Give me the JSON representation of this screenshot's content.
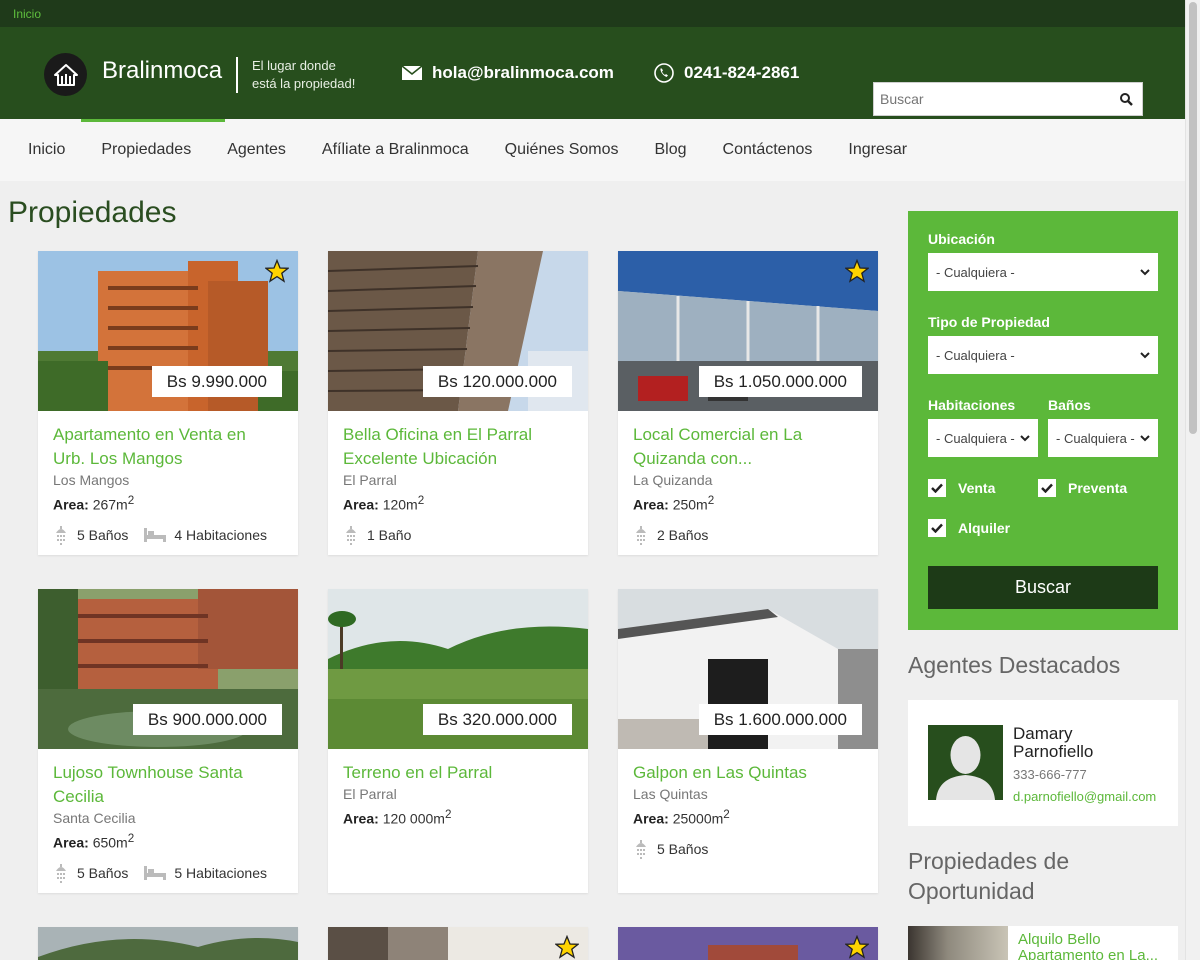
{
  "topbar": {
    "breadcrumb": "Inicio"
  },
  "header": {
    "brand": "Bralinmoca",
    "tagline_line1": "El lugar donde",
    "tagline_line2": "está la propiedad!",
    "email": "hola@bralinmoca.com",
    "phone": "0241-824-2861",
    "search_placeholder": "Buscar"
  },
  "nav": {
    "items": [
      {
        "label": "Inicio"
      },
      {
        "label": "Propiedades"
      },
      {
        "label": "Agentes"
      },
      {
        "label": "Afíliate a Bralinmoca"
      },
      {
        "label": "Quiénes Somos"
      },
      {
        "label": "Blog"
      },
      {
        "label": "Contáctenos"
      },
      {
        "label": "Ingresar"
      }
    ]
  },
  "main": {
    "title": "Propiedades",
    "properties": [
      {
        "price": "Bs 9.990.000",
        "title1": "Apartamento en Venta en",
        "title2": "Urb. Los Mangos",
        "location": "Los Mangos",
        "area_label": "Area:",
        "area": "267m",
        "baths": "5 Baños",
        "rooms": "4 Habitaciones",
        "featured": true
      },
      {
        "price": "Bs 120.000.000",
        "title1": "Bella Oficina en El Parral",
        "title2": "Excelente Ubicación",
        "location": "El Parral",
        "area_label": "Area:",
        "area": "120m",
        "baths": "1 Baño",
        "rooms": "",
        "featured": false
      },
      {
        "price": "Bs 1.050.000.000",
        "title1": "Local Comercial en La",
        "title2": "Quizanda con...",
        "location": "La Quizanda",
        "area_label": "Area:",
        "area": "250m",
        "baths": "2 Baños",
        "rooms": "",
        "featured": true
      },
      {
        "price": "Bs 900.000.000",
        "title1": "Lujoso Townhouse Santa",
        "title2": "Cecilia",
        "location": "Santa Cecilia",
        "area_label": "Area:",
        "area": "650m",
        "baths": "5 Baños",
        "rooms": "5 Habitaciones",
        "featured": false
      },
      {
        "price": "Bs 320.000.000",
        "title1": "Terreno en el Parral",
        "title2": "",
        "location": "El Parral",
        "area_label": "Area:",
        "area": "120 000m",
        "baths": "",
        "rooms": "",
        "featured": false
      },
      {
        "price": "Bs 1.600.000.000",
        "title1": "Galpon en Las Quintas",
        "title2": "",
        "location": "Las Quintas",
        "area_label": "Area:",
        "area": "25000m",
        "baths": "5 Baños",
        "rooms": "",
        "featured": false
      }
    ],
    "area_sup": "2"
  },
  "filter": {
    "ubicacion_label": "Ubicación",
    "ubicacion_value": "- Cualquiera -",
    "tipo_label": "Tipo de Propiedad",
    "tipo_value": "- Cualquiera -",
    "habitaciones_label": "Habitaciones",
    "habitaciones_value": "- Cualquiera -",
    "banos_label": "Baños",
    "banos_value": "- Cualquiera -",
    "venta": "Venta",
    "preventa": "Preventa",
    "alquiler": "Alquiler",
    "button": "Buscar"
  },
  "sidebar": {
    "agents_title": "Agentes Destacados",
    "agent": {
      "name_line1": "Damary",
      "name_line2": "Parnofiello",
      "phone": "333-666-777",
      "email": "d.parnofiello@gmail.com"
    },
    "opportunity_title_line1": "Propiedades de",
    "opportunity_title_line2": "Oportunidad",
    "opportunity_item_line1": "Alquilo Bello",
    "opportunity_item_line2": "Apartamento en La..."
  },
  "colors": {
    "header_green": "#274e1d",
    "accent_green": "#5cb83a",
    "dark_button": "#1d3a17",
    "star": "#ffd400"
  }
}
